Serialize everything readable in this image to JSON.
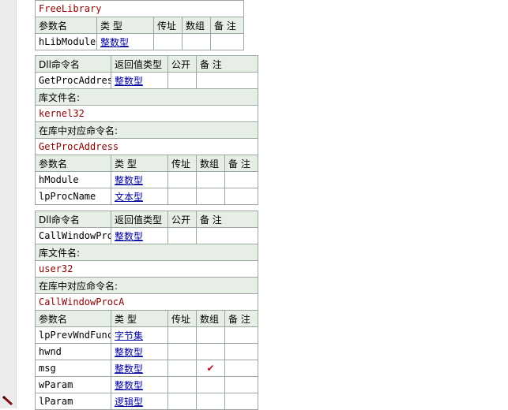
{
  "header_headers": {
    "col1": "参数名",
    "col2": "类 型",
    "col3": "传址",
    "col4": "数组",
    "col5": "备 注"
  },
  "dll_headers": {
    "col1": "Dll命令名",
    "col2": "返回值类型",
    "col3": "公开",
    "col4": "备 注"
  },
  "section_labels": {
    "library": "库文件名:",
    "command": "在库中对应命令名:"
  },
  "top_block": {
    "library_name": "FreeLibrary",
    "params": [
      {
        "name": "hLibModule",
        "type": "整数型",
        "by_ref": false,
        "array": false,
        "note": ""
      }
    ]
  },
  "blocks": [
    {
      "command_name": "GetProcAddress",
      "return_type": "整数型",
      "public": "",
      "note": "",
      "library": "kernel32",
      "library_command": "GetProcAddress",
      "params": [
        {
          "name": "hModule",
          "type": "整数型",
          "by_ref": false,
          "array": false,
          "note": ""
        },
        {
          "name": "lpProcName",
          "type": "文本型",
          "by_ref": false,
          "array": false,
          "note": ""
        }
      ]
    },
    {
      "command_name": "CallWindowProc",
      "return_type": "整数型",
      "public": "",
      "note": "",
      "library": "user32",
      "library_command": "CallWindowProcA",
      "params": [
        {
          "name": "lpPrevWndFunc",
          "type": "字节集",
          "by_ref": false,
          "array": false,
          "note": ""
        },
        {
          "name": "hwnd",
          "type": "整数型",
          "by_ref": false,
          "array": false,
          "note": ""
        },
        {
          "name": "msg",
          "type": "整数型",
          "by_ref": false,
          "array": true,
          "note": ""
        },
        {
          "name": "wParam",
          "type": "整数型",
          "by_ref": false,
          "array": false,
          "note": ""
        },
        {
          "name": "lParam",
          "type": "逻辑型",
          "by_ref": false,
          "array": false,
          "note": ""
        }
      ]
    }
  ],
  "icons": {
    "gutter": "pen-icon",
    "array_mark": "check-icon"
  },
  "colors": {
    "header_bg": "#e6eee6",
    "border": "#9aa8a0",
    "type_link": "#0000a0",
    "library_text": "#8b0000",
    "check": "#b0141e"
  }
}
